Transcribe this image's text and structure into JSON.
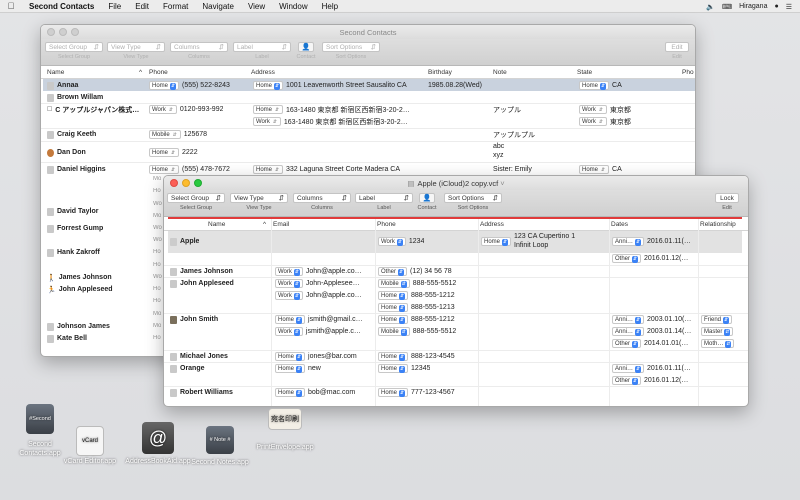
{
  "menubar": {
    "app_name": "Second Contacts",
    "items": [
      "File",
      "Edit",
      "Format",
      "Navigate",
      "View",
      "Window",
      "Help"
    ],
    "input_method": "Hiragana"
  },
  "win1": {
    "title": "Second Contacts",
    "toolbar": {
      "select_group": "Select Group",
      "view_type": "View Type",
      "columns": "Columns",
      "label": "Label",
      "sort_options": "Sort Options",
      "edit": "Edit",
      "lbl_select_group": "Select Group",
      "lbl_view_type": "View Type",
      "lbl_columns": "Columns",
      "lbl_label": "Label",
      "lbl_contact": "Contact",
      "lbl_sort": "Sort Options",
      "lbl_edit": "Edit"
    },
    "headers": {
      "name": "Name",
      "phone": "Phone",
      "address": "Address",
      "birthday": "Birthday",
      "note": "Note",
      "state": "State",
      "pho": "Pho"
    },
    "rows": [
      {
        "name": "Annaa",
        "phone_label": "Home",
        "phone": "(555) 522-8243",
        "addr_label": "Home",
        "address": "1001  Leavenworth Street Sausalito CA",
        "birthday": "1985.08.28(Wed)",
        "note": "",
        "state_label": "Home",
        "state": "CA"
      },
      {
        "name": "Brown Willam",
        "phone_label": "",
        "phone": "",
        "addr_label": "",
        "address": "",
        "birthday": "",
        "note": "",
        "state_label": "",
        "state": ""
      },
      {
        "name": "C アップルジャパン株式…",
        "phone_label": "Work",
        "phone": "0120-993-992",
        "addr_label": "Home",
        "address": "163-1480 東京都 新宿区西新宿3-20-2…",
        "birthday": "",
        "note": "アップル",
        "state_label": "Work",
        "state": "東京都"
      },
      {
        "name": "",
        "phone_label": "",
        "phone": "",
        "addr_label": "Work",
        "address": "163-1480 東京都 新宿区西新宿3-20-2…",
        "birthday": "",
        "note": "",
        "state_label": "Work",
        "state": "東京都"
      },
      {
        "name": "Craig Keeth",
        "phone_label": "Mobile",
        "phone": "125678",
        "addr_label": "",
        "address": "",
        "birthday": "",
        "note": "アップルプル",
        "state_label": "",
        "state": ""
      },
      {
        "name": "Dan Don",
        "phone_label": "Home",
        "phone": "2222",
        "addr_label": "",
        "address": "",
        "birthday": "",
        "note": "abc\nxyz",
        "state_label": "",
        "state": ""
      },
      {
        "name": "Daniel Higgins",
        "phone_label": "Home",
        "phone": "(555) 478-7672",
        "addr_label": "Home",
        "address": "332 Laguna Street Corte Madera CA",
        "birthday": "",
        "note": "Sister: Emily",
        "state_label": "Home",
        "state": "CA"
      }
    ],
    "left_names": [
      "David Taylor",
      "Forrest Gump",
      "Hank Zakroff",
      "James Johnson",
      "John Appleseed",
      "Johnson James",
      "Kate Bell"
    ],
    "left_labels": [
      "Mo",
      "Ho",
      "Wo",
      "Mo",
      "Wo",
      "Wo",
      "Ho",
      "Ho",
      "Wo",
      "Ho",
      "Ho",
      "Mo",
      "Mo",
      "Ho"
    ]
  },
  "win2": {
    "title": "Apple (iCloud)2 copy.vcf",
    "toolbar": {
      "select_group": "Select Group",
      "view_type": "View Type",
      "columns": "Columns",
      "label": "Label",
      "sort_options": "Sort Options",
      "lock": "Lock",
      "lbl_select_group": "Select Group",
      "lbl_view_type": "View Type",
      "lbl_columns": "Columns",
      "lbl_label": "Label",
      "lbl_contact": "Contact",
      "lbl_sort": "Sort Options",
      "lbl_edit": "Edit"
    },
    "headers": {
      "name": "Name",
      "email": "Email",
      "phone": "Phone",
      "address": "Address",
      "dates": "Dates",
      "relationship": "Relationship"
    },
    "rows": [
      {
        "name": "Apple",
        "email_label": "",
        "email": "",
        "phone_label": "Work",
        "phone": "1234",
        "addr_label": "Home",
        "address": "123 CA Cupertino 1\nInfinit Loop",
        "date_label": "Anni…",
        "date": "2016.01.11(…",
        "rel_label": "",
        "rel": ""
      },
      {
        "name": "",
        "email_label": "",
        "email": "",
        "phone_label": "",
        "phone": "",
        "addr_label": "",
        "address": "",
        "date_label": "Other",
        "date": "2016.01.12(…",
        "rel_label": "",
        "rel": ""
      },
      {
        "name": "James Johnson",
        "email_label": "Work",
        "email": "John@apple.co…",
        "phone_label": "Other",
        "phone": "(12) 34 56 78",
        "addr_label": "",
        "address": "",
        "date_label": "",
        "date": "",
        "rel_label": "",
        "rel": ""
      },
      {
        "name": "John Appleseed",
        "email_label": "Work",
        "email": "John-Appleseе…",
        "phone_label": "Mobile",
        "phone": "888-555-5512",
        "addr_label": "",
        "address": "",
        "date_label": "",
        "date": "",
        "rel_label": "",
        "rel": ""
      },
      {
        "name": "",
        "email_label": "Work",
        "email": "John@apple.co…",
        "phone_label": "Home",
        "phone": "888-555-1212",
        "addr_label": "",
        "address": "",
        "date_label": "",
        "date": "",
        "rel_label": "",
        "rel": ""
      },
      {
        "name": "",
        "email_label": "",
        "email": "",
        "phone_label": "Home",
        "phone": "888-555-1213",
        "addr_label": "",
        "address": "",
        "date_label": "",
        "date": "",
        "rel_label": "",
        "rel": ""
      },
      {
        "name": "John Smith",
        "email_label": "Home",
        "email": "jsmith@gmail.c…",
        "phone_label": "Home",
        "phone": "888-555-1212",
        "addr_label": "",
        "address": "",
        "date_label": "Anni…",
        "date": "2003.01.10(…",
        "rel_label": "Friend",
        "rel": ""
      },
      {
        "name": "",
        "email_label": "Work",
        "email": "jsmith@apple.c…",
        "phone_label": "Mobile",
        "phone": "888-555-5512",
        "addr_label": "",
        "address": "",
        "date_label": "Anni…",
        "date": "2003.01.14(…",
        "rel_label": "Master",
        "rel": ""
      },
      {
        "name": "",
        "email_label": "",
        "email": "",
        "phone_label": "",
        "phone": "",
        "addr_label": "",
        "address": "",
        "date_label": "Other",
        "date": "2014.01.01(…",
        "rel_label": "Moth…",
        "rel": ""
      },
      {
        "name": "Michael Jones",
        "email_label": "Home",
        "email": "jones@bar.com",
        "phone_label": "Home",
        "phone": "888-123-4545",
        "addr_label": "",
        "address": "",
        "date_label": "",
        "date": "",
        "rel_label": "",
        "rel": ""
      },
      {
        "name": "Orange",
        "email_label": "Home",
        "email": "new",
        "phone_label": "Home",
        "phone": "12345",
        "addr_label": "",
        "address": "",
        "date_label": "Anni…",
        "date": "2016.01.11(…",
        "rel_label": "",
        "rel": ""
      },
      {
        "name": "",
        "email_label": "",
        "email": "",
        "phone_label": "",
        "phone": "",
        "addr_label": "",
        "address": "",
        "date_label": "Other",
        "date": "2016.01.12(…",
        "rel_label": "",
        "rel": ""
      },
      {
        "name": "Robert Williams",
        "email_label": "Home",
        "email": "bob@mac.com",
        "phone_label": "Home",
        "phone": "777-123-4567",
        "addr_label": "",
        "address": "",
        "date_label": "",
        "date": "",
        "rel_label": "",
        "rel": ""
      }
    ]
  },
  "desktop": [
    {
      "label": "Second Contacts.app",
      "icon_text": "#Second"
    },
    {
      "label": "vCard Editor.app",
      "icon_text": "vCard"
    },
    {
      "label": "AddressBookAid.app",
      "icon_text": "@"
    },
    {
      "label": "Second Notes.app",
      "icon_text": "# Note #"
    },
    {
      "label": "PrintEnvelope.app",
      "icon_text": "宛名印刷"
    }
  ]
}
